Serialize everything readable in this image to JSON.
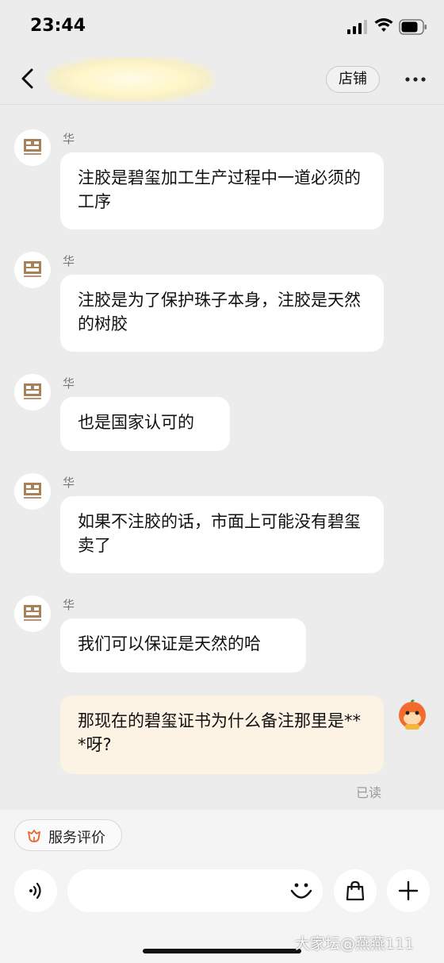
{
  "status_bar": {
    "time": "23:44"
  },
  "header": {
    "store_label": "店铺"
  },
  "messages": [
    {
      "sender": "华",
      "text": "注胶是碧玺加工生产过程中一道必须的工序"
    },
    {
      "sender": "华",
      "text": "注胶是为了保护珠子本身，注胶是天然的树胶"
    },
    {
      "sender": "华",
      "text": "也是国家认可的"
    },
    {
      "sender": "华",
      "text": "如果不注胶的话，市面上可能没有碧玺卖了"
    },
    {
      "sender": "华",
      "text": "我们可以保证是天然的哈"
    }
  ],
  "my_message": {
    "text": "那现在的碧玺证书为什么备注那里是***呀?",
    "status": "已读"
  },
  "bottom": {
    "review_label": "服务评价"
  },
  "watermark": "大家坛@燕燕111",
  "colors": {
    "my_bubble": "#fdf3e4",
    "accent": "#e8632c",
    "background": "#ececec"
  }
}
